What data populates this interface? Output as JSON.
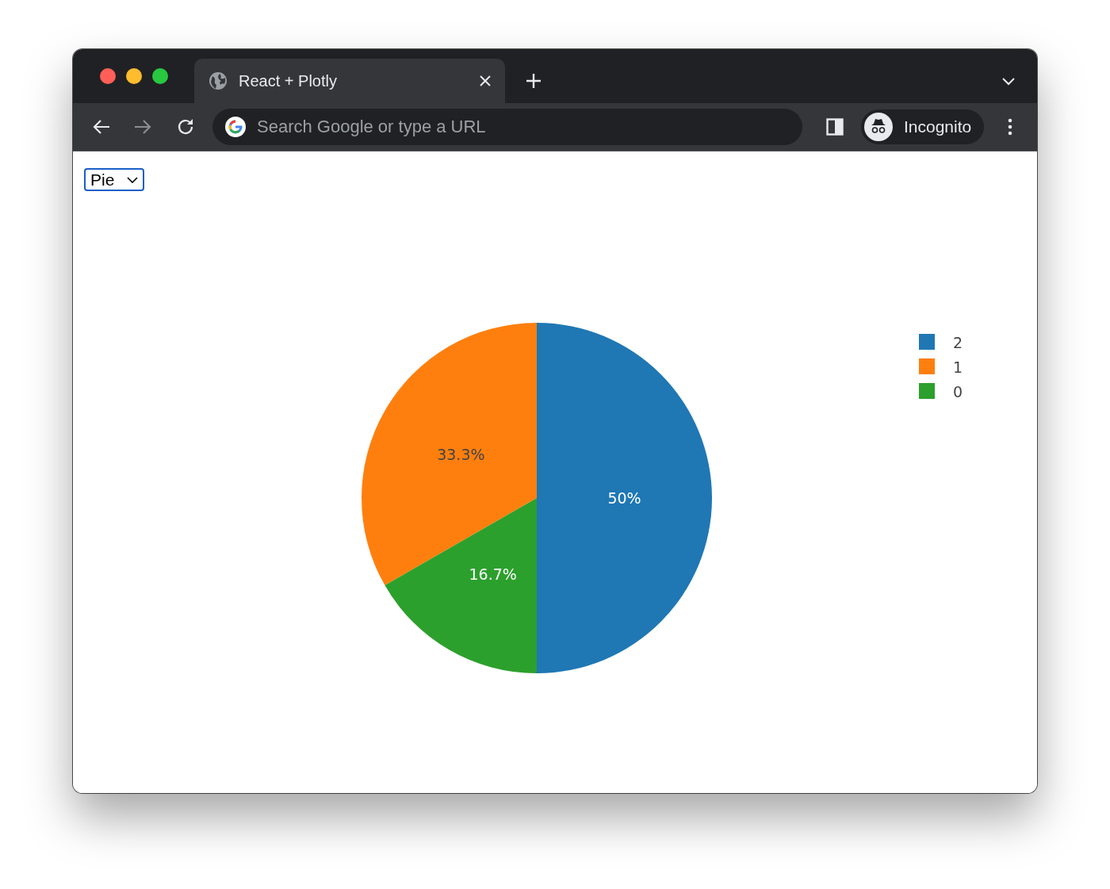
{
  "browser": {
    "tab": {
      "title": "React + Plotly"
    },
    "address_bar": {
      "placeholder": "Search Google or type a URL"
    },
    "profile": {
      "label": "Incognito"
    }
  },
  "page": {
    "chart_select": {
      "value": "Pie"
    },
    "chart_data": {
      "type": "pie",
      "categories": [
        "2",
        "1",
        "0"
      ],
      "values": [
        50,
        33.3,
        16.7
      ],
      "legend": "right",
      "colors": [
        "#1f77b4",
        "#ff7f0e",
        "#2ca02c"
      ],
      "value_labels": [
        "50%",
        "33.3%",
        "16.7%"
      ]
    }
  }
}
